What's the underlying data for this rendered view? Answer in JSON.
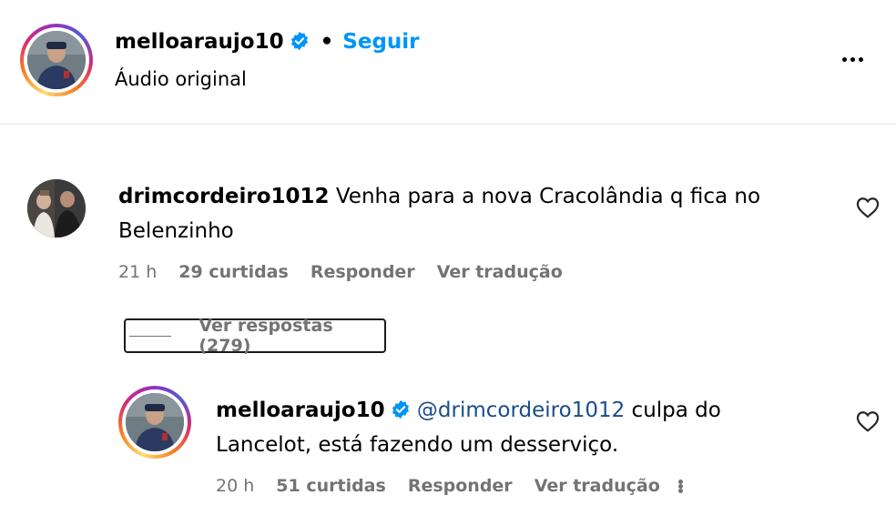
{
  "post_header": {
    "username": "melloaraujo10",
    "separator": "•",
    "follow_label": "Seguir",
    "audio_label": "Áudio original"
  },
  "comment": {
    "username": "drimcordeiro1012",
    "text_line1": "Venha para a nova Cracolândia q fica no",
    "text_line2": "Belenzinho",
    "time": "21 h",
    "likes": "29 curtidas",
    "reply_label": "Responder",
    "translate_label": "Ver tradução",
    "view_replies_label": "Ver respostas (279)"
  },
  "reply": {
    "username": "melloaraujo10",
    "mention": "@drimcordeiro1012",
    "text_after_mention": " culpa do",
    "text_line2": "Lancelot, está fazendo um desserviço.",
    "time": "20 h",
    "likes": "51 curtidas",
    "reply_label": "Responder",
    "translate_label": "Ver tradução"
  },
  "colors": {
    "link_blue": "#0095f6",
    "verified_blue": "#0095f6",
    "mention_blue": "#1a4c8a",
    "meta_gray": "#737373"
  },
  "icons": {
    "verified": "verified-badge-icon",
    "heart": "heart-outline-icon",
    "more": "more-horizontal-icon"
  }
}
